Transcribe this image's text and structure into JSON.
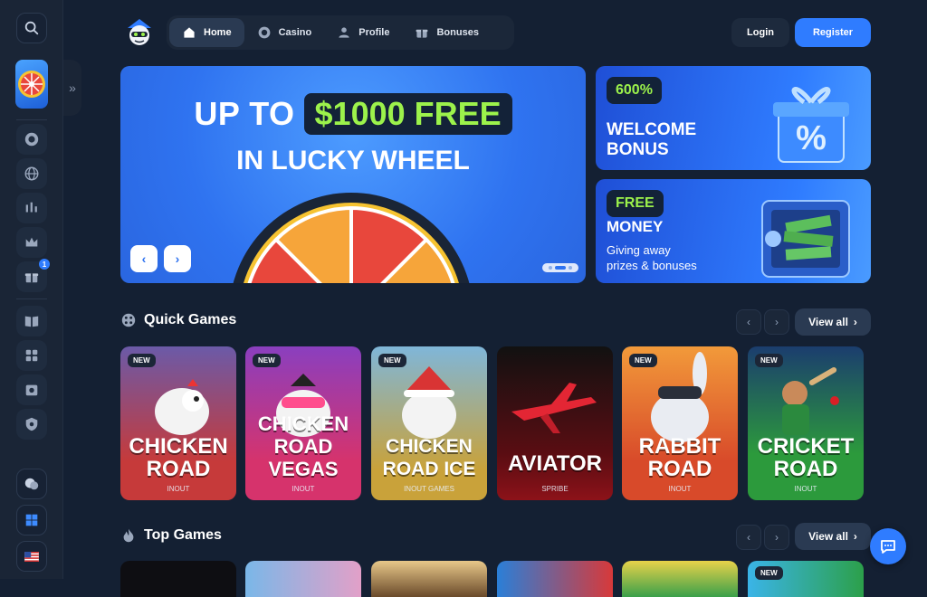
{
  "nav": {
    "items": [
      {
        "label": "Home",
        "icon": "home-icon",
        "active": true
      },
      {
        "label": "Casino",
        "icon": "casino-chip-icon",
        "active": false
      },
      {
        "label": "Profile",
        "icon": "profile-icon",
        "active": false
      },
      {
        "label": "Bonuses",
        "icon": "gift-icon",
        "active": false
      }
    ],
    "login_label": "Login",
    "register_label": "Register"
  },
  "sidebar": {
    "badge_count": "1",
    "icons": [
      "search-icon",
      "lucky-wheel-thumb",
      "casino-chip-icon",
      "globe-icon",
      "chart-icon",
      "crown-icon",
      "gift-icon",
      "book-icon",
      "games-icon",
      "vault-icon",
      "shield-icon",
      "chat-bubbles-icon",
      "windows-icon",
      "us-flag-icon"
    ]
  },
  "hero": {
    "line1_prefix": "UP TO",
    "line1_highlight": "$1000 FREE",
    "line2": "IN LUCKY WHEEL"
  },
  "promos": [
    {
      "tag": "600%",
      "title_line1": "WELCOME",
      "title_line2": "BONUS"
    },
    {
      "tag": "FREE",
      "title_line1": "MONEY",
      "subtitle_line1": "Giving away",
      "subtitle_line2": "prizes & bonuses"
    }
  ],
  "sections": {
    "quick_games_title": "Quick Games",
    "top_games_title": "Top Games",
    "view_all_label": "View all"
  },
  "quick_games": [
    {
      "line1": "CHICKEN",
      "line2": "ROAD",
      "provider": "INOUT",
      "new": "NEW"
    },
    {
      "line1": "CHICKEN",
      "line2": "ROAD VEGAS",
      "provider": "INOUT",
      "new": "NEW"
    },
    {
      "line1": "CHICKEN",
      "line2": "ROAD ICE",
      "provider": "INOUT GAMES",
      "new": "NEW"
    },
    {
      "line1": "AVIATOR",
      "line2": "",
      "provider": "SPRIBE",
      "new": ""
    },
    {
      "line1": "RABBIT",
      "line2": "ROAD",
      "provider": "INOUT",
      "new": "NEW"
    },
    {
      "line1": "CRICKET",
      "line2": "ROAD",
      "provider": "INOUT",
      "new": "NEW"
    }
  ],
  "top_games": [
    {
      "new": ""
    },
    {
      "new": ""
    },
    {
      "new": ""
    },
    {
      "new": ""
    },
    {
      "new": ""
    },
    {
      "new": "NEW"
    }
  ],
  "colors": {
    "background": "#142033",
    "accent": "#2f7cff",
    "highlight_green": "#9cf24b"
  }
}
